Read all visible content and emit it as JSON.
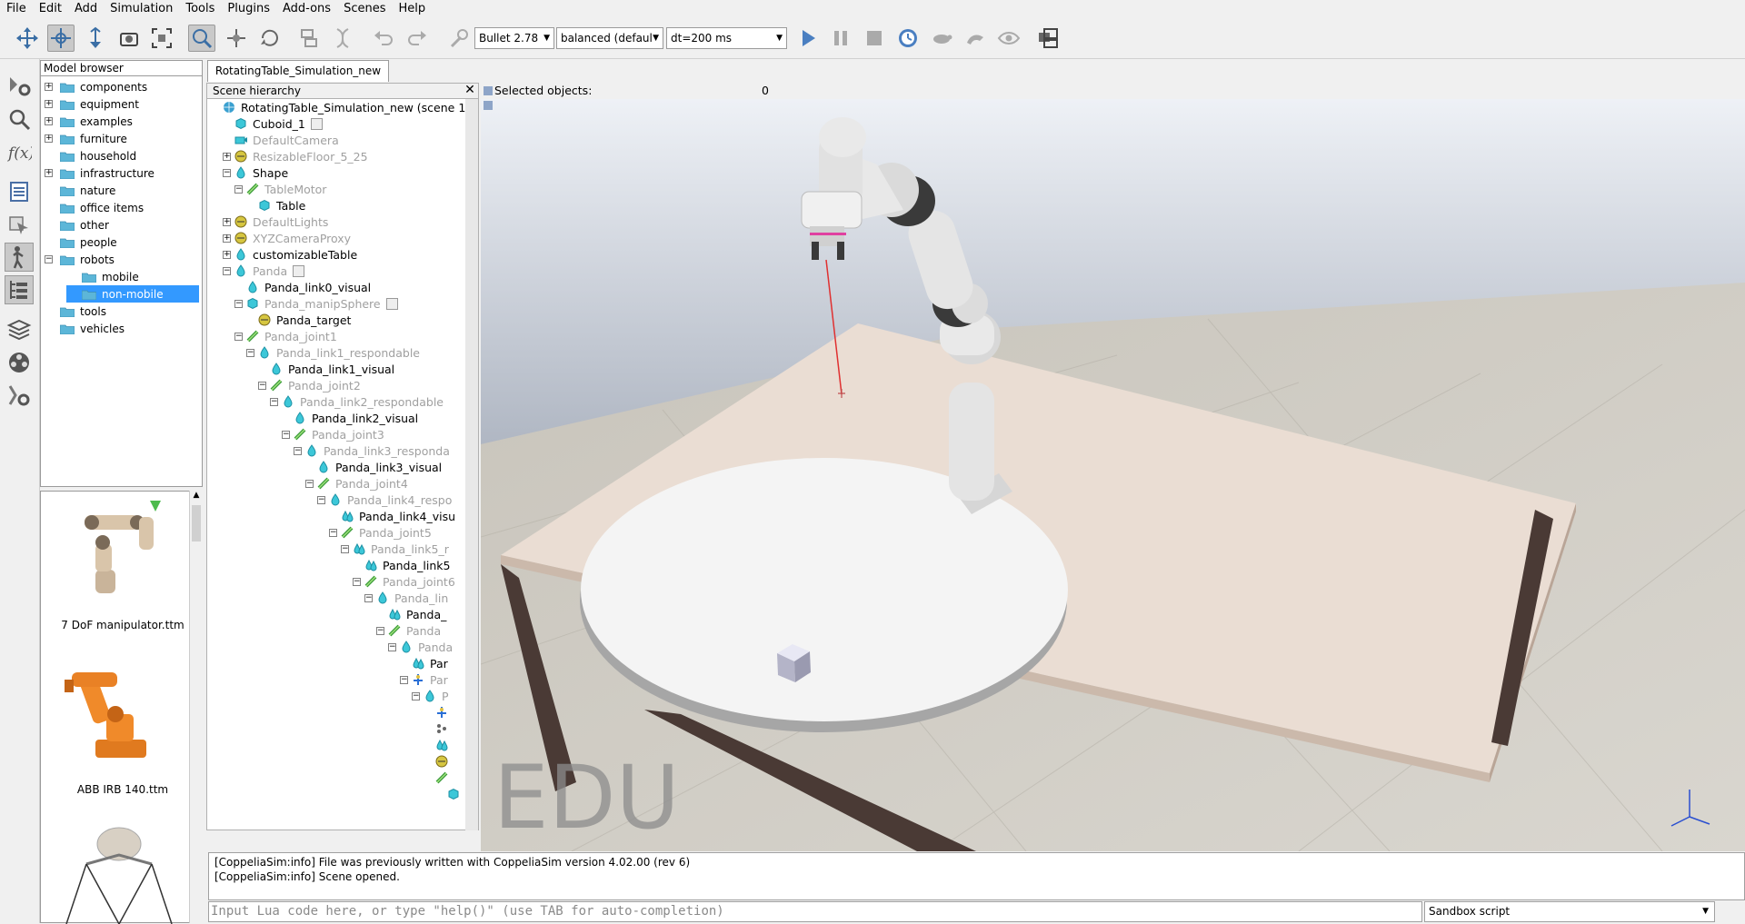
{
  "menu": [
    "File",
    "Edit",
    "Add",
    "Simulation",
    "Tools",
    "Plugins",
    "Add-ons",
    "Scenes",
    "Help"
  ],
  "toolbar": {
    "icons": [
      "camera-pan-icon",
      "camera-rotate-icon",
      "camera-shift-icon",
      "camera-angle-icon",
      "fit-to-view-icon",
      "click-select-icon",
      "object-shift-icon",
      "object-rotate-icon",
      "assemble-icon",
      "transfer-dna-icon",
      "undo-icon",
      "redo-icon",
      "dynamics-toggle-icon"
    ],
    "engine": "Bullet 2.78",
    "accuracy": "balanced (defaul",
    "timestep": "dt=200 ms",
    "sim_icons": [
      "start-simulation-icon",
      "pause-simulation-icon",
      "stop-simulation-icon",
      "realtime-icon",
      "slow-down-icon",
      "speed-up-icon",
      "visualization-icon",
      "page-selector-icon"
    ]
  },
  "leftstrip": [
    "simulation-settings-icon",
    "scripts-icon",
    "calculation-modules-icon",
    "collections-icon",
    "selection-icon",
    "shapes-edit-icon",
    "model-browser-icon",
    "scene-hierarchy-icon",
    "layers-icon",
    "video-recorder-icon",
    "user-settings-icon"
  ],
  "model_browser": {
    "title": "Model browser",
    "items": [
      {
        "label": "components",
        "expander": "+",
        "indent": 0
      },
      {
        "label": "equipment",
        "expander": "+",
        "indent": 0
      },
      {
        "label": "examples",
        "expander": "+",
        "indent": 0
      },
      {
        "label": "furniture",
        "expander": "+",
        "indent": 0
      },
      {
        "label": "household",
        "expander": "",
        "indent": 0
      },
      {
        "label": "infrastructure",
        "expander": "+",
        "indent": 0
      },
      {
        "label": "nature",
        "expander": "",
        "indent": 0
      },
      {
        "label": "office items",
        "expander": "",
        "indent": 0
      },
      {
        "label": "other",
        "expander": "",
        "indent": 0
      },
      {
        "label": "people",
        "expander": "",
        "indent": 0
      },
      {
        "label": "robots",
        "expander": "−",
        "indent": 0
      },
      {
        "label": "mobile",
        "expander": "",
        "indent": 1
      },
      {
        "label": "non-mobile",
        "expander": "",
        "indent": 1,
        "selected": true
      },
      {
        "label": "tools",
        "expander": "",
        "indent": 0
      },
      {
        "label": "vehicles",
        "expander": "",
        "indent": 0
      }
    ],
    "thumbnails": [
      "7 DoF manipulator.ttm",
      "ABB IRB 140.ttm"
    ]
  },
  "scene": {
    "tab": "RotatingTable_Simulation_new",
    "hierarchy_title": "Scene hierarchy",
    "close": "✕",
    "rows": [
      {
        "label": "RotatingTable_Simulation_new (scene 1)",
        "indent": 0,
        "icon": "globe",
        "dim": false,
        "exp": ""
      },
      {
        "label": "Cuboid_1",
        "indent": 1,
        "icon": "cube",
        "dim": false,
        "exp": "",
        "script": true
      },
      {
        "label": "DefaultCamera",
        "indent": 1,
        "icon": "camera",
        "dim": true,
        "exp": ""
      },
      {
        "label": "ResizableFloor_5_25",
        "indent": 1,
        "icon": "model",
        "dim": true,
        "exp": "+"
      },
      {
        "label": "Shape",
        "indent": 1,
        "icon": "drop",
        "dim": false,
        "exp": "−"
      },
      {
        "label": "TableMotor",
        "indent": 2,
        "icon": "joint",
        "dim": true,
        "exp": "−"
      },
      {
        "label": "Table",
        "indent": 3,
        "icon": "cube",
        "dim": false,
        "exp": ""
      },
      {
        "label": "DefaultLights",
        "indent": 1,
        "icon": "model",
        "dim": true,
        "exp": "+"
      },
      {
        "label": "XYZCameraProxy",
        "indent": 1,
        "icon": "model",
        "dim": true,
        "exp": "+"
      },
      {
        "label": "customizableTable",
        "indent": 1,
        "icon": "drop",
        "dim": false,
        "exp": "+"
      },
      {
        "label": "Panda",
        "indent": 1,
        "icon": "drop",
        "dim": true,
        "exp": "−",
        "script": true
      },
      {
        "label": "Panda_link0_visual",
        "indent": 2,
        "icon": "drop",
        "dim": false,
        "exp": ""
      },
      {
        "label": "Panda_manipSphere",
        "indent": 2,
        "icon": "cube",
        "dim": true,
        "exp": "−",
        "script": true
      },
      {
        "label": "Panda_target",
        "indent": 3,
        "icon": "model",
        "dim": false,
        "exp": ""
      },
      {
        "label": "Panda_joint1",
        "indent": 2,
        "icon": "joint",
        "dim": true,
        "exp": "−"
      },
      {
        "label": "Panda_link1_respondable",
        "indent": 3,
        "icon": "drop",
        "dim": true,
        "exp": "−"
      },
      {
        "label": "Panda_link1_visual",
        "indent": 4,
        "icon": "drop",
        "dim": false,
        "exp": ""
      },
      {
        "label": "Panda_joint2",
        "indent": 4,
        "icon": "joint",
        "dim": true,
        "exp": "−"
      },
      {
        "label": "Panda_link2_respondable",
        "indent": 5,
        "icon": "drop",
        "dim": true,
        "exp": "−"
      },
      {
        "label": "Panda_link2_visual",
        "indent": 6,
        "icon": "drop",
        "dim": false,
        "exp": ""
      },
      {
        "label": "Panda_joint3",
        "indent": 6,
        "icon": "joint",
        "dim": true,
        "exp": "−"
      },
      {
        "label": "Panda_link3_responda",
        "indent": 7,
        "icon": "drop",
        "dim": true,
        "exp": "−"
      },
      {
        "label": "Panda_link3_visual",
        "indent": 8,
        "icon": "drop",
        "dim": false,
        "exp": ""
      },
      {
        "label": "Panda_joint4",
        "indent": 8,
        "icon": "joint",
        "dim": true,
        "exp": "−"
      },
      {
        "label": "Panda_link4_respo",
        "indent": 9,
        "icon": "drop",
        "dim": true,
        "exp": "−"
      },
      {
        "label": "Panda_link4_visu",
        "indent": 10,
        "icon": "drops",
        "dim": false,
        "exp": ""
      },
      {
        "label": "Panda_joint5",
        "indent": 10,
        "icon": "joint",
        "dim": true,
        "exp": "−"
      },
      {
        "label": "Panda_link5_r",
        "indent": 11,
        "icon": "drops",
        "dim": true,
        "exp": "−"
      },
      {
        "label": "Panda_link5",
        "indent": 12,
        "icon": "drops",
        "dim": false,
        "exp": ""
      },
      {
        "label": "Panda_joint6",
        "indent": 12,
        "icon": "joint",
        "dim": true,
        "exp": "−"
      },
      {
        "label": "Panda_lin",
        "indent": 13,
        "icon": "drop",
        "dim": true,
        "exp": "−"
      },
      {
        "label": "Panda_",
        "indent": 14,
        "icon": "drops",
        "dim": false,
        "exp": ""
      },
      {
        "label": "Panda",
        "indent": 14,
        "icon": "joint",
        "dim": true,
        "exp": "−"
      },
      {
        "label": "Panda",
        "indent": 15,
        "icon": "drop",
        "dim": true,
        "exp": "−"
      },
      {
        "label": "Par",
        "indent": 16,
        "icon": "drops",
        "dim": false,
        "exp": ""
      },
      {
        "label": "Par",
        "indent": 16,
        "icon": "dummy",
        "dim": true,
        "exp": "−"
      },
      {
        "label": "P",
        "indent": 17,
        "icon": "drop",
        "dim": true,
        "exp": "−"
      },
      {
        "label": "",
        "indent": 18,
        "icon": "dummy",
        "dim": false,
        "exp": ""
      },
      {
        "label": "",
        "indent": 18,
        "icon": "dots",
        "dim": false,
        "exp": ""
      },
      {
        "label": "",
        "indent": 18,
        "icon": "drops",
        "dim": false,
        "exp": ""
      },
      {
        "label": "",
        "indent": 18,
        "icon": "model",
        "dim": false,
        "exp": ""
      },
      {
        "label": "",
        "indent": 18,
        "icon": "joint",
        "dim": false,
        "exp": ""
      },
      {
        "label": "",
        "indent": 19,
        "icon": "cube",
        "dim": false,
        "exp": ""
      },
      {
        "label": "",
        "indent": 20,
        "icon": "",
        "dim": false,
        "exp": ""
      }
    ]
  },
  "viewport": {
    "selected_label": "Selected objects:",
    "selected_count": "0",
    "watermark": "EDU"
  },
  "console": {
    "lines": [
      "[CoppeliaSim:info] File was previously written with CoppeliaSim version 4.02.00 (rev 6)",
      "[CoppeliaSim:info] Scene opened."
    ],
    "input_placeholder": "Input Lua code here, or type \"help()\" (use TAB for auto-completion)",
    "script_select": "Sandbox script"
  },
  "colors": {
    "accent": "#3399ff",
    "object_icon": "#27c2d6",
    "dim_text": "#a0a0a0"
  }
}
